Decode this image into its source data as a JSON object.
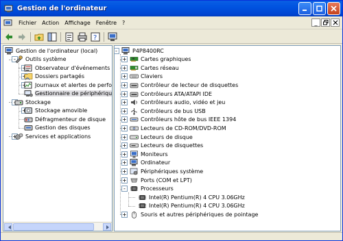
{
  "window": {
    "title": "Gestion de l'ordinateur"
  },
  "menu": {
    "items": [
      "Fichier",
      "Action",
      "Affichage",
      "Fenêtre",
      "?"
    ]
  },
  "left_tree": [
    {
      "label": "Gestion de l'ordinateur (local)",
      "level": 0,
      "expander": "",
      "icon": "computer-icon"
    },
    {
      "label": "Outils système",
      "level": 1,
      "expander": "-",
      "icon": "tools-icon"
    },
    {
      "label": "Observateur d'événements",
      "level": 2,
      "expander": "+",
      "icon": "event-viewer-icon"
    },
    {
      "label": "Dossiers partagés",
      "level": 2,
      "expander": "+",
      "icon": "shared-folder-icon"
    },
    {
      "label": "Journaux et alertes de perfo",
      "level": 2,
      "expander": "+",
      "icon": "perf-log-icon"
    },
    {
      "label": "Gestionnaire de périphérique",
      "level": 2,
      "expander": "",
      "icon": "device-manager-icon",
      "selected": true
    },
    {
      "label": "Stockage",
      "level": 1,
      "expander": "-",
      "icon": "storage-icon"
    },
    {
      "label": "Stockage amovible",
      "level": 2,
      "expander": "+",
      "icon": "removable-storage-icon"
    },
    {
      "label": "Défragmenteur de disque",
      "level": 2,
      "expander": "",
      "icon": "defrag-icon"
    },
    {
      "label": "Gestion des disques",
      "level": 2,
      "expander": "",
      "icon": "disk-management-icon"
    },
    {
      "label": "Services et applications",
      "level": 1,
      "expander": "+",
      "icon": "services-icon"
    }
  ],
  "right_tree": [
    {
      "label": "P4P8400RC",
      "level": 0,
      "expander": "-",
      "icon": "computer-icon"
    },
    {
      "label": "Cartes graphiques",
      "level": 1,
      "expander": "+",
      "icon": "display-adapter-icon"
    },
    {
      "label": "Cartes réseau",
      "level": 1,
      "expander": "+",
      "icon": "network-card-icon"
    },
    {
      "label": "Claviers",
      "level": 1,
      "expander": "+",
      "icon": "keyboard-icon"
    },
    {
      "label": "Contrôleur de lecteur de disquettes",
      "level": 1,
      "expander": "+",
      "icon": "floppy-controller-icon"
    },
    {
      "label": "Contrôleurs ATA/ATAPI IDE",
      "level": 1,
      "expander": "+",
      "icon": "ide-controller-icon"
    },
    {
      "label": "Contrôleurs audio, vidéo et jeu",
      "level": 1,
      "expander": "+",
      "icon": "audio-icon"
    },
    {
      "label": "Contrôleurs de bus USB",
      "level": 1,
      "expander": "+",
      "icon": "usb-icon"
    },
    {
      "label": "Contrôleurs hôte de bus IEEE 1394",
      "level": 1,
      "expander": "+",
      "icon": "ieee1394-icon"
    },
    {
      "label": "Lecteurs de CD-ROM/DVD-ROM",
      "level": 1,
      "expander": "+",
      "icon": "cdrom-icon"
    },
    {
      "label": "Lecteurs de disque",
      "level": 1,
      "expander": "+",
      "icon": "disk-drive-icon"
    },
    {
      "label": "Lecteurs de disquettes",
      "level": 1,
      "expander": "+",
      "icon": "floppy-drive-icon"
    },
    {
      "label": "Moniteurs",
      "level": 1,
      "expander": "+",
      "icon": "monitor-icon"
    },
    {
      "label": "Ordinateur",
      "level": 1,
      "expander": "+",
      "icon": "computer-icon"
    },
    {
      "label": "Périphériques système",
      "level": 1,
      "expander": "+",
      "icon": "system-devices-icon"
    },
    {
      "label": "Ports (COM et LPT)",
      "level": 1,
      "expander": "+",
      "icon": "ports-icon"
    },
    {
      "label": "Processeurs",
      "level": 1,
      "expander": "-",
      "icon": "processor-icon"
    },
    {
      "label": "Intel(R) Pentium(R) 4 CPU 3.06GHz",
      "level": 2,
      "expander": "",
      "icon": "processor-icon"
    },
    {
      "label": "Intel(R) Pentium(R) 4 CPU 3.06GHz",
      "level": 2,
      "expander": "",
      "icon": "processor-icon"
    },
    {
      "label": "Souris et autres périphériques de pointage",
      "level": 1,
      "expander": "+",
      "icon": "mouse-icon"
    }
  ]
}
